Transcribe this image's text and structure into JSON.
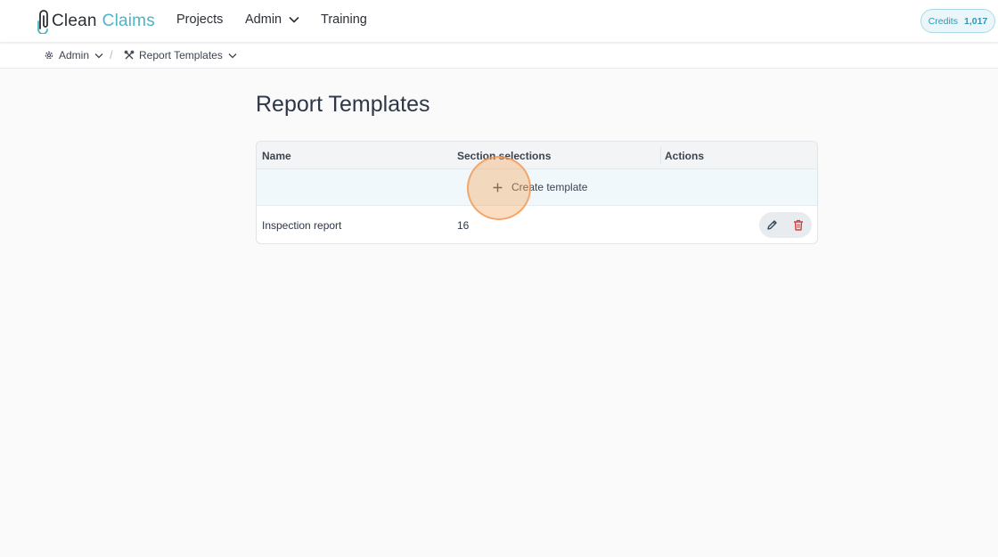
{
  "app": {
    "logo": {
      "clean": "Clean",
      "claims": "Claims"
    },
    "nav": [
      {
        "label": "Projects"
      },
      {
        "label": "Admin"
      },
      {
        "label": "Training"
      }
    ],
    "credits": {
      "label": "Credits",
      "value": "1,017"
    }
  },
  "breadcrumb": {
    "items": [
      {
        "label": "Admin",
        "icon": "gear-icon"
      },
      {
        "label": "Report Templates",
        "icon": "tools-icon"
      }
    ],
    "separator": "/"
  },
  "page": {
    "title": "Report Templates"
  },
  "table": {
    "columns": [
      "Name",
      "Section selections",
      "Actions"
    ],
    "create_label": "Create template",
    "rows": [
      {
        "name": "Inspection report",
        "sections": "16"
      }
    ]
  },
  "colors": {
    "accent": "#4fb3c8",
    "delete": "#d14343",
    "click_marker": "#f5a65d"
  }
}
